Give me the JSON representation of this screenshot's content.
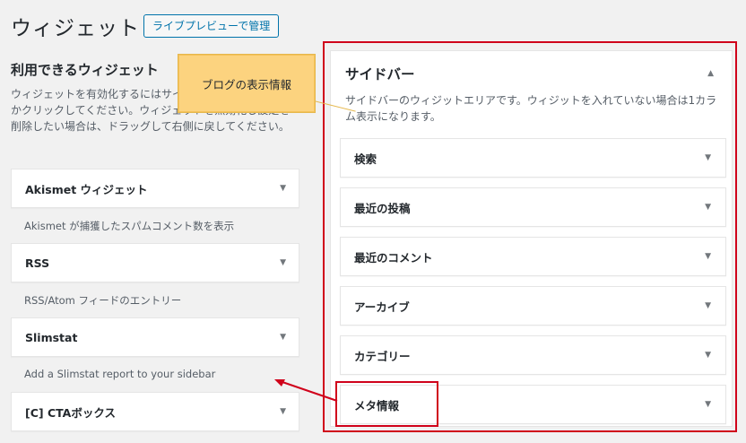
{
  "header": {
    "title": "ウィジェット",
    "live_preview_button": "ライブプレビューで管理"
  },
  "available": {
    "title": "利用できるウィジェット",
    "description": "ウィジェットを有効化するにはサイドバーにドラッグするかクリックしてください。ウィジェットを無効化し設定を削除したい場合は、ドラッグして右側に戻してください。",
    "widgets": [
      {
        "name": "Akismet ウィジェット",
        "desc": "Akismet が捕獲したスパムコメント数を表示"
      },
      {
        "name": "RSS",
        "desc": "RSS/Atom フィードのエントリー"
      },
      {
        "name": "Slimstat",
        "desc": "Add a Slimstat report to your sidebar"
      },
      {
        "name": "[C] CTAボックス",
        "desc": ""
      }
    ]
  },
  "tooltip": {
    "text": "ブログの表示情報"
  },
  "sidebar": {
    "title": "サイドバー",
    "description": "サイドバーのウィジットエリアです。ウィジットを入れていない場合は1カラム表示になります。",
    "widgets": [
      "検索",
      "最近の投稿",
      "最近のコメント",
      "アーカイブ",
      "カテゴリー",
      "メタ情報"
    ]
  },
  "icons": {
    "caret_down": "▼",
    "caret_up": "▲"
  },
  "colors": {
    "accent": "#0073aa",
    "highlight_red": "#d0021b",
    "tooltip_bg": "#fcd37f"
  }
}
